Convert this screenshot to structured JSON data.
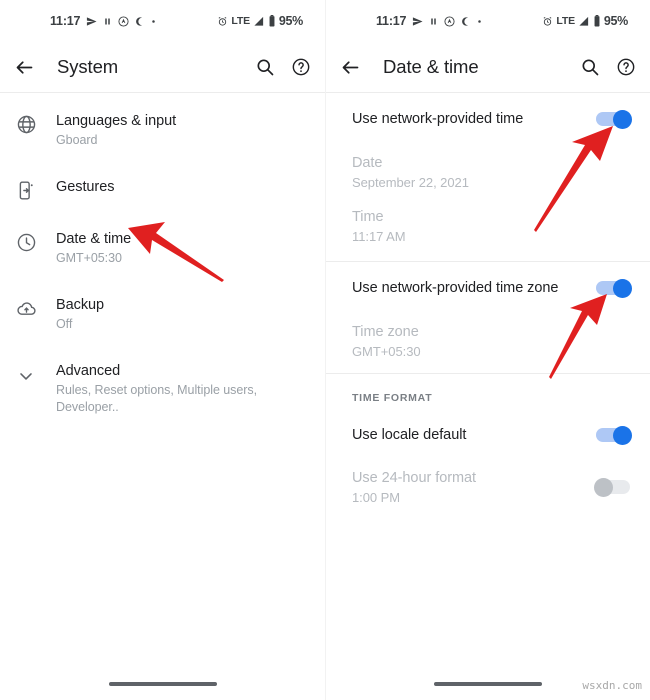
{
  "status_bar": {
    "time": "11:17",
    "network_label": "LTE",
    "battery_label": "95%",
    "icons": [
      "send-icon",
      "pause-icon",
      "assistant-icon",
      "crescent-moon-icon",
      "dot-icon",
      "alarm-icon",
      "signal-icon",
      "battery-icon"
    ]
  },
  "colors": {
    "accent": "#1a73e8",
    "accent_track": "#aec8f5",
    "off_thumb": "#bdc1c6",
    "off_track": "#e8eaed",
    "arrow_red": "#e02020",
    "text_primary": "#202124",
    "text_secondary": "#9aa0a6",
    "text_disabled": "#b6babf"
  },
  "left_screen": {
    "app_bar": {
      "title": "System",
      "back_icon": "arrow-back-icon",
      "search_icon": "search-icon",
      "help_icon": "help-circle-icon"
    },
    "items": [
      {
        "icon": "globe-icon",
        "title": "Languages & input",
        "subtitle": "Gboard"
      },
      {
        "icon": "gestures-icon",
        "title": "Gestures",
        "subtitle": ""
      },
      {
        "icon": "clock-icon",
        "title": "Date & time",
        "subtitle": "GMT+05:30"
      },
      {
        "icon": "cloud-upload-icon",
        "title": "Backup",
        "subtitle": "Off"
      },
      {
        "icon": "chevron-down-icon",
        "title": "Advanced",
        "subtitle": "Rules, Reset options, Multiple users, Developer.."
      }
    ]
  },
  "right_screen": {
    "app_bar": {
      "title": "Date & time",
      "back_icon": "arrow-back-icon",
      "search_icon": "search-icon",
      "help_icon": "help-circle-icon"
    },
    "prefs": [
      {
        "title": "Use network-provided time",
        "subtitle": "",
        "toggle": "on",
        "enabled": true
      },
      {
        "title": "Date",
        "subtitle": "September 22, 2021",
        "toggle": null,
        "enabled": false
      },
      {
        "title": "Time",
        "subtitle": "11:17 AM",
        "toggle": null,
        "enabled": false
      },
      {
        "title": "Use network-provided time zone",
        "subtitle": "",
        "toggle": "on",
        "enabled": true
      },
      {
        "title": "Time zone",
        "subtitle": "GMT+05:30",
        "toggle": null,
        "enabled": false
      }
    ],
    "section_label": "TIME FORMAT",
    "format_prefs": [
      {
        "title": "Use locale default",
        "subtitle": "",
        "toggle": "on",
        "enabled": true
      },
      {
        "title": "Use 24-hour format",
        "subtitle": "1:00 PM",
        "toggle": "off",
        "enabled": false
      }
    ]
  },
  "annotations": {
    "arrow_count": 3,
    "arrow_targets": [
      "date-and-time-row",
      "use-network-provided-time-toggle",
      "use-network-provided-time-zone-toggle"
    ]
  },
  "watermark": {
    "text": "wsxdn.com"
  }
}
